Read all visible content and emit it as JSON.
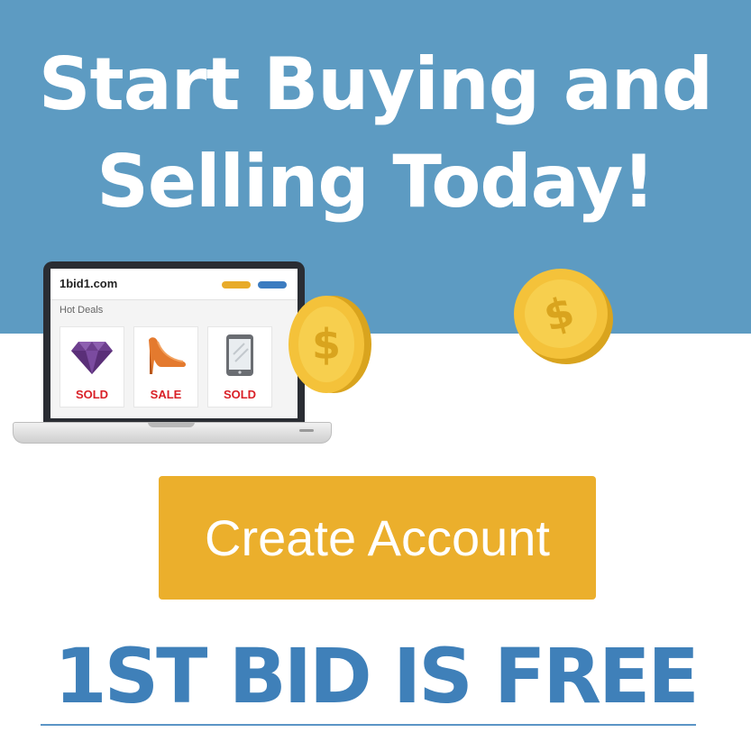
{
  "headline": {
    "line1": "Start Buying and",
    "line2": "Selling Today!"
  },
  "laptop": {
    "site_name": "1bid1.com",
    "section_title": "Hot Deals",
    "cards": [
      {
        "icon": "diamond-icon",
        "label": "SOLD"
      },
      {
        "icon": "high-heel-shoe-icon",
        "label": "SALE"
      },
      {
        "icon": "tablet-icon",
        "label": "SOLD"
      }
    ]
  },
  "cta": {
    "label": "Create Account"
  },
  "promo": {
    "text": "1ST BID IS FREE"
  },
  "colors": {
    "hero_blue": "#5d9bc2",
    "button_gold": "#ebaf2c",
    "promo_blue": "#3f80b9",
    "label_red": "#d92027"
  }
}
